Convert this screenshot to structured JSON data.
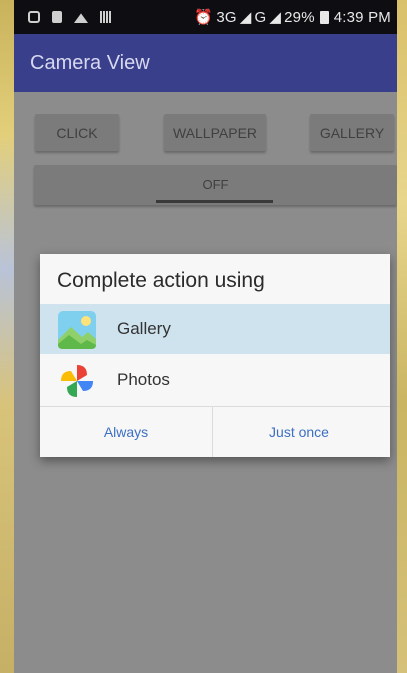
{
  "status_bar": {
    "network": "3G",
    "network2": "G",
    "battery": "29%",
    "time": "4:39 PM"
  },
  "app_bar": {
    "title": "Camera View"
  },
  "buttons": {
    "click": "CLICK",
    "wallpaper": "WALLPAPER",
    "gallery": "GALLERY",
    "toggle": "OFF"
  },
  "dialog": {
    "title": "Complete action using",
    "options": [
      {
        "label": "Gallery",
        "icon": "gallery-icon",
        "selected": true
      },
      {
        "label": "Photos",
        "icon": "photos-pinwheel-icon",
        "selected": false
      }
    ],
    "actions": {
      "always": "Always",
      "just_once": "Just once"
    }
  },
  "colors": {
    "app_bar": "#3a3f8c",
    "accent": "#3d6fc2",
    "selected_row": "#cfe3ef"
  }
}
